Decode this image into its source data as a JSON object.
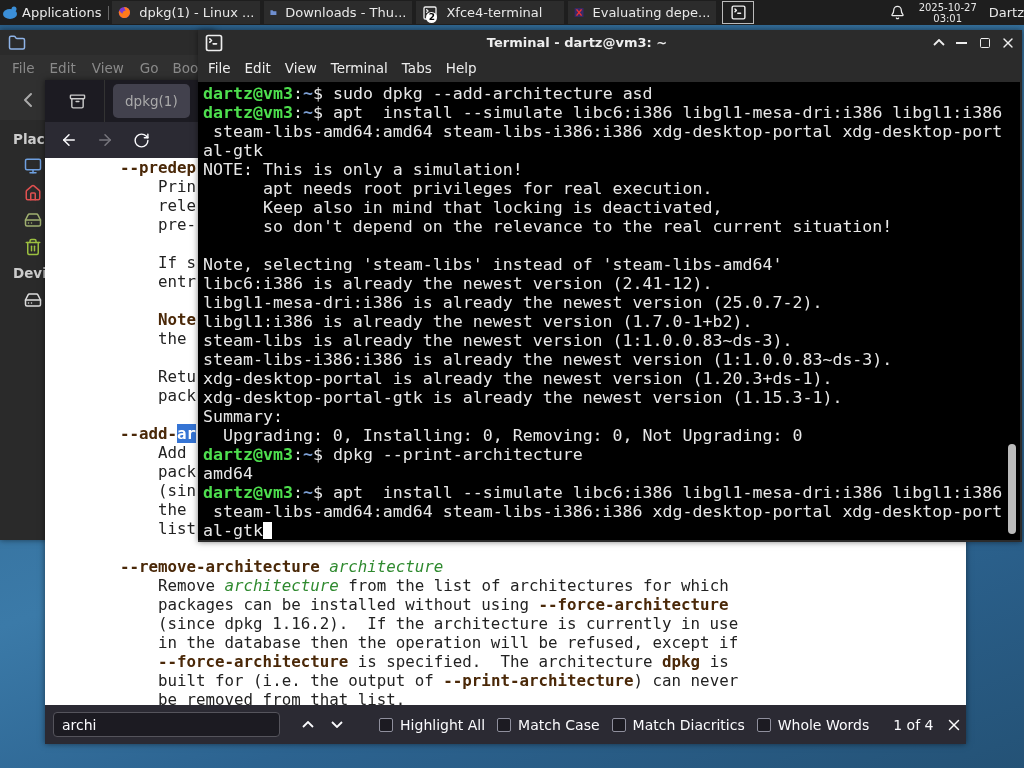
{
  "taskbar": {
    "apps_menu": "Applications",
    "tasks": [
      {
        "kind": "browser",
        "label": "dpkg(1) - Linux ..."
      },
      {
        "kind": "folder",
        "label": "Downloads - Thu..."
      },
      {
        "kind": "terminal",
        "label": "Xfce4-terminal",
        "badge": "2"
      },
      {
        "kind": "document",
        "label": "Evaluating depe..."
      }
    ],
    "clock": {
      "date": "2025-10-27",
      "time": "03:01"
    },
    "user": "Dartz"
  },
  "file_manager": {
    "menu": [
      "File",
      "Edit",
      "View",
      "Go",
      "Boo"
    ],
    "sidebar": [
      {
        "kind": "heading",
        "label": "Plac"
      },
      {
        "kind": "computer"
      },
      {
        "kind": "home"
      },
      {
        "kind": "drive"
      },
      {
        "kind": "trash"
      },
      {
        "kind": "heading",
        "label": "Devi"
      },
      {
        "kind": "disk"
      }
    ]
  },
  "browser": {
    "tab": {
      "label": "dpkg(1)",
      "selected": true
    },
    "nav": [
      {
        "kind": "back",
        "disabled": false
      },
      {
        "kind": "forward",
        "disabled": true
      },
      {
        "kind": "reload",
        "disabled": false
      }
    ],
    "manpage": [
      {
        "kind": "option",
        "segs": [
          {
            "t": "--predep",
            "bold": true
          }
        ]
      },
      {
        "kind": "body",
        "segs": [
          {
            "t": "Prin"
          }
        ]
      },
      {
        "kind": "body",
        "segs": [
          {
            "t": "rele"
          }
        ]
      },
      {
        "kind": "body",
        "segs": [
          {
            "t": "pre-"
          }
        ]
      },
      {
        "kind": "gap"
      },
      {
        "kind": "body",
        "segs": [
          {
            "t": "If s"
          }
        ]
      },
      {
        "kind": "body",
        "segs": [
          {
            "t": "entr"
          }
        ]
      },
      {
        "kind": "gap"
      },
      {
        "kind": "body",
        "segs": [
          {
            "t": "Note",
            "bold": true
          }
        ]
      },
      {
        "kind": "body",
        "segs": [
          {
            "t": "the"
          }
        ]
      },
      {
        "kind": "gap"
      },
      {
        "kind": "body",
        "segs": [
          {
            "t": "Retu"
          }
        ]
      },
      {
        "kind": "body",
        "segs": [
          {
            "t": "pack"
          }
        ]
      },
      {
        "kind": "gap"
      },
      {
        "kind": "option",
        "segs": [
          {
            "t": "--add-",
            "bold": true
          },
          {
            "t": "ar",
            "bold": true,
            "highlighted": true
          }
        ]
      },
      {
        "kind": "body",
        "segs": [
          {
            "t": "Add"
          }
        ]
      },
      {
        "kind": "body",
        "segs": [
          {
            "t": "pack"
          }
        ]
      },
      {
        "kind": "body",
        "segs": [
          {
            "t": "(sin"
          }
        ]
      },
      {
        "kind": "body",
        "segs": [
          {
            "t": "the"
          }
        ]
      },
      {
        "kind": "body",
        "segs": [
          {
            "t": "list"
          }
        ]
      },
      {
        "kind": "gap"
      },
      {
        "kind": "option",
        "segs": [
          {
            "t": "--remove-architecture",
            "bold": true
          },
          {
            "t": " architecture",
            "italic": true
          }
        ]
      },
      {
        "kind": "body",
        "segs": [
          {
            "t": "Remove "
          },
          {
            "t": "architecture",
            "italic": true
          },
          {
            "t": " from the list of architectures for which"
          }
        ]
      },
      {
        "kind": "body",
        "segs": [
          {
            "t": "packages can be installed without using "
          },
          {
            "t": "--force-architecture",
            "bold": true
          }
        ]
      },
      {
        "kind": "body",
        "segs": [
          {
            "t": "(since dpkg 1.16.2).  If the architecture is currently in use"
          }
        ]
      },
      {
        "kind": "body",
        "segs": [
          {
            "t": "in the database then the operation will be refused, except if"
          }
        ]
      },
      {
        "kind": "body",
        "segs": [
          {
            "t": "--force-architecture",
            "bold": true
          },
          {
            "t": " is specified.  The architecture "
          },
          {
            "t": "dpkg",
            "bold": true
          },
          {
            "t": " is"
          }
        ]
      },
      {
        "kind": "body",
        "segs": [
          {
            "t": "built for (i.e. the output of "
          },
          {
            "t": "--print-architecture",
            "bold": true
          },
          {
            "t": ") can never"
          }
        ]
      },
      {
        "kind": "body",
        "segs": [
          {
            "t": "be removed from that list."
          }
        ]
      }
    ],
    "find_bar": {
      "value": "archi",
      "options": [
        {
          "label": "Highlight All",
          "checked": false
        },
        {
          "label": "Match Case",
          "checked": false
        },
        {
          "label": "Match Diacritics",
          "checked": false
        },
        {
          "label": "Whole Words",
          "checked": false
        }
      ],
      "matches": "1 of 4"
    }
  },
  "terminal": {
    "title": "Terminal - dartz@vm3: ~",
    "menu": [
      "File",
      "Edit",
      "View",
      "Terminal",
      "Tabs",
      "Help"
    ],
    "lines": [
      {
        "kind": "prompt",
        "user": "dartz@vm3",
        "sep": ":",
        "dir": "~",
        "sign": "$",
        "text": " sudo dpkg --add-architecture asd"
      },
      {
        "kind": "prompt",
        "user": "dartz@vm3",
        "sep": ":",
        "dir": "~",
        "sign": "$",
        "text": " apt  install --simulate libc6:i386 libgl1-mesa-dri:i386 libgl1:i386"
      },
      {
        "kind": "output",
        "text": " steam-libs-amd64:amd64 steam-libs-i386:i386 xdg-desktop-portal xdg-desktop-port"
      },
      {
        "kind": "output",
        "text": "al-gtk"
      },
      {
        "kind": "output",
        "text": "NOTE: This is only a simulation!"
      },
      {
        "kind": "output",
        "text": "      apt needs root privileges for real execution."
      },
      {
        "kind": "output",
        "text": "      Keep also in mind that locking is deactivated,"
      },
      {
        "kind": "output",
        "text": "      so don't depend on the relevance to the real current situation!"
      },
      {
        "kind": "blank"
      },
      {
        "kind": "output",
        "text": "Note, selecting 'steam-libs' instead of 'steam-libs-amd64'"
      },
      {
        "kind": "output",
        "text": "libc6:i386 is already the newest version (2.41-12)."
      },
      {
        "kind": "output",
        "text": "libgl1-mesa-dri:i386 is already the newest version (25.0.7-2)."
      },
      {
        "kind": "output",
        "text": "libgl1:i386 is already the newest version (1.7.0-1+b2)."
      },
      {
        "kind": "output",
        "text": "steam-libs is already the newest version (1:1.0.0.83~ds-3)."
      },
      {
        "kind": "output",
        "text": "steam-libs-i386:i386 is already the newest version (1:1.0.0.83~ds-3)."
      },
      {
        "kind": "output",
        "text": "xdg-desktop-portal is already the newest version (1.20.3+ds-1)."
      },
      {
        "kind": "output",
        "text": "xdg-desktop-portal-gtk is already the newest version (1.15.3-1)."
      },
      {
        "kind": "output",
        "text": "Summary:"
      },
      {
        "kind": "output",
        "text": "  Upgrading: 0, Installing: 0, Removing: 0, Not Upgrading: 0"
      },
      {
        "kind": "prompt",
        "user": "dartz@vm3",
        "sep": ":",
        "dir": "~",
        "sign": "$",
        "text": " dpkg --print-architecture"
      },
      {
        "kind": "output",
        "text": "amd64"
      },
      {
        "kind": "prompt",
        "user": "dartz@vm3",
        "sep": ":",
        "dir": "~",
        "sign": "$",
        "text": " apt  install --simulate libc6:i386 libgl1-mesa-dri:i386 libgl1:i386"
      },
      {
        "kind": "output",
        "text": " steam-libs-amd64:amd64 steam-libs-i386:i386 xdg-desktop-portal xdg-desktop-port"
      },
      {
        "kind": "output",
        "text": "al-gtk",
        "cursor": true
      }
    ]
  }
}
